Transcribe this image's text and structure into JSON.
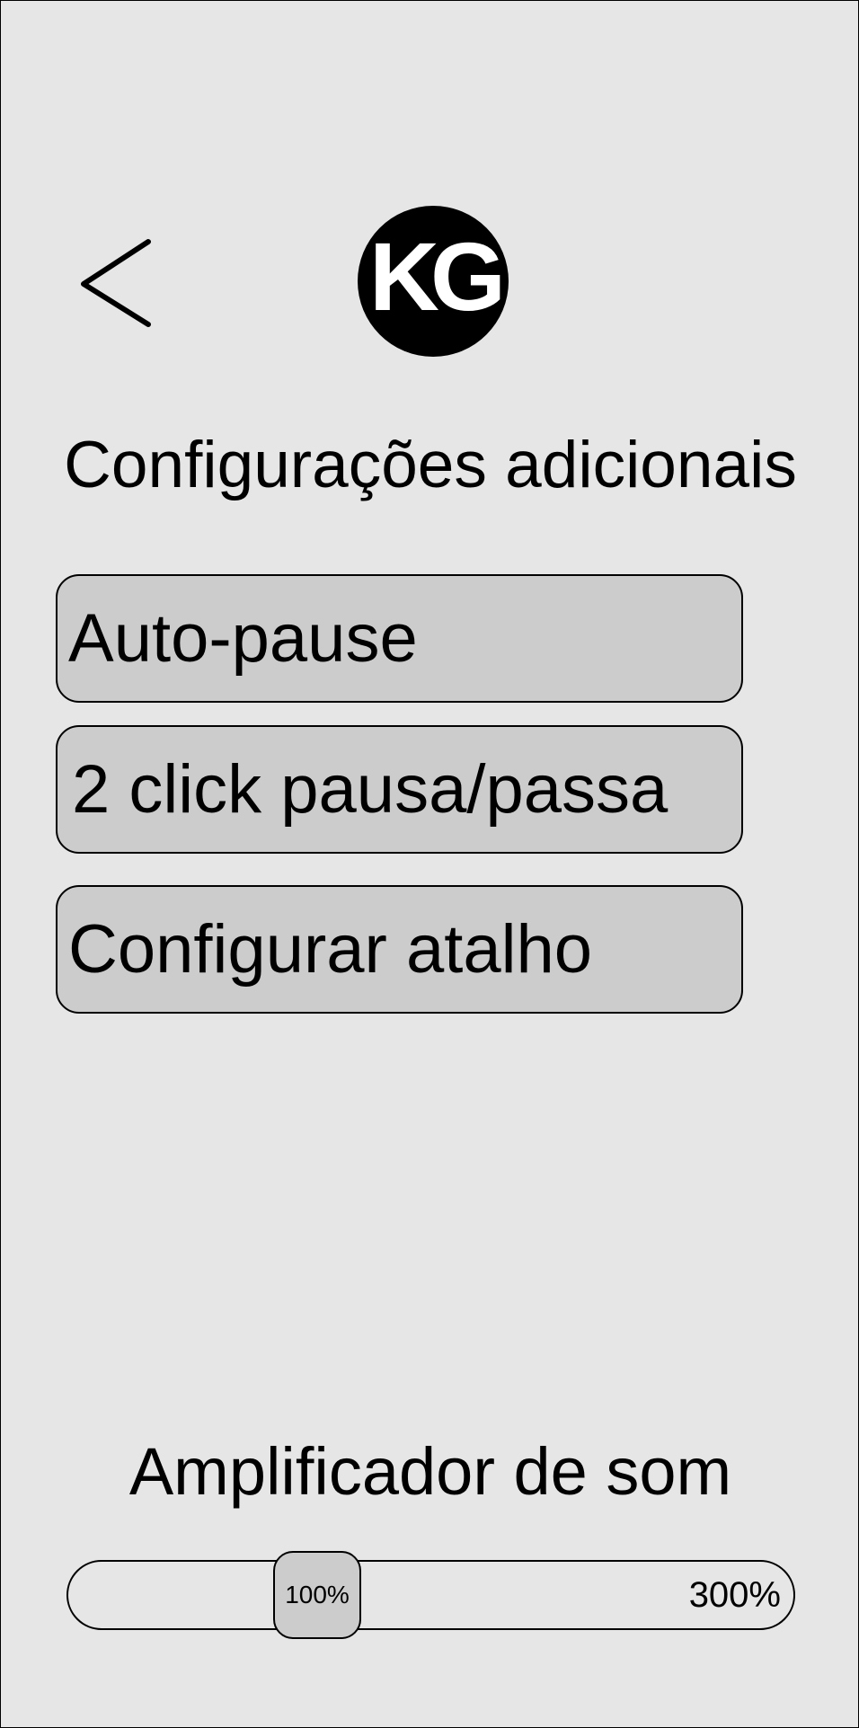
{
  "header": {
    "back_icon": "chevron-left-icon",
    "logo_text": "KG"
  },
  "page_title": "Configurações adicionais",
  "options": [
    {
      "label": "Auto-pause"
    },
    {
      "label": "2 click pausa/passa"
    },
    {
      "label": "Configurar atalho"
    }
  ],
  "sound_amplifier": {
    "title": "Amplificador de som",
    "current_value_label": "100%",
    "max_label": "300%",
    "current_value": 100,
    "max_value": 300
  },
  "colors": {
    "background": "#e6e6e6",
    "button_fill": "#cccccc",
    "border": "#000000"
  }
}
